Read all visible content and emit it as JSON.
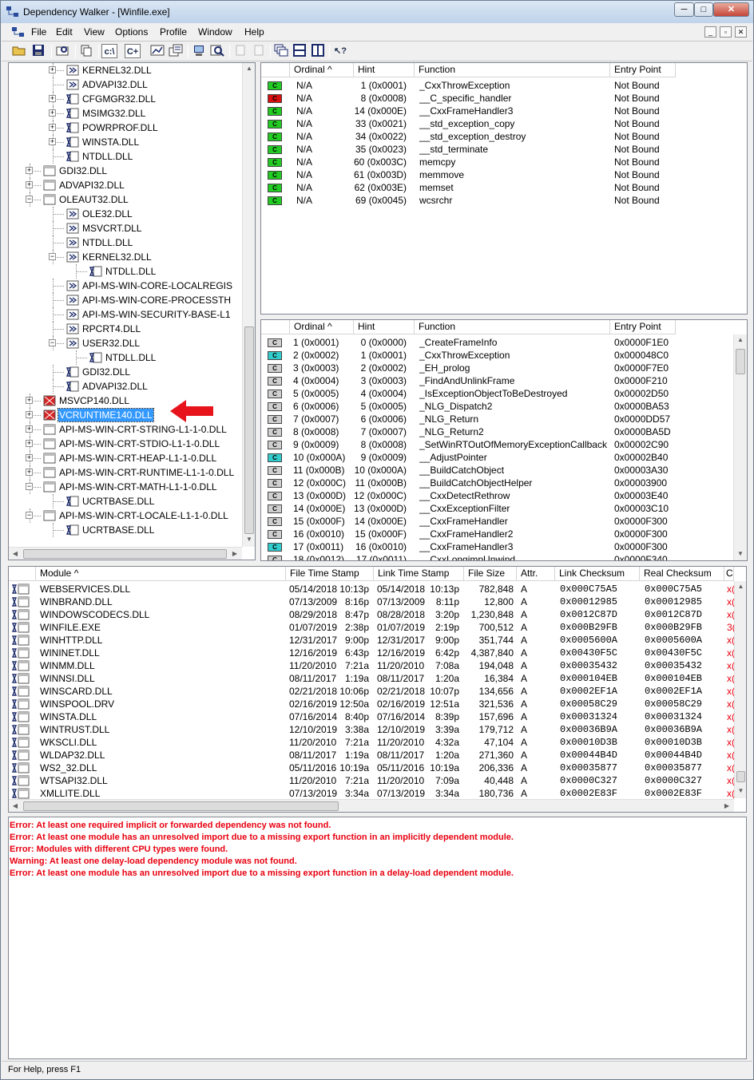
{
  "window": {
    "title": "Dependency Walker - [Winfile.exe]",
    "min": "─",
    "max": "□",
    "close": "✕"
  },
  "menu": [
    "File",
    "Edit",
    "View",
    "Options",
    "Profile",
    "Window",
    "Help"
  ],
  "mdi_controls": [
    "_",
    "▫",
    "✕"
  ],
  "toolbar": {
    "paths": "c:\\",
    "cpp": "C+"
  },
  "tree": [
    {
      "name": "KERNEL32.DLL",
      "depth": 2,
      "exp": "+",
      "icon": "forward"
    },
    {
      "name": "ADVAPI32.DLL",
      "depth": 2,
      "exp": "",
      "icon": "forward"
    },
    {
      "name": "CFGMGR32.DLL",
      "depth": 2,
      "exp": "+",
      "icon": "delay"
    },
    {
      "name": "MSIMG32.DLL",
      "depth": 2,
      "exp": "+",
      "icon": "delay"
    },
    {
      "name": "POWRPROF.DLL",
      "depth": 2,
      "exp": "+",
      "icon": "delay"
    },
    {
      "name": "WINSTA.DLL",
      "depth": 2,
      "exp": "+",
      "icon": "delay"
    },
    {
      "name": "NTDLL.DLL",
      "depth": 2,
      "exp": "",
      "icon": "delay"
    },
    {
      "name": "GDI32.DLL",
      "depth": 1,
      "exp": "+",
      "icon": "normal"
    },
    {
      "name": "ADVAPI32.DLL",
      "depth": 1,
      "exp": "+",
      "icon": "normal"
    },
    {
      "name": "OLEAUT32.DLL",
      "depth": 1,
      "exp": "-",
      "icon": "normal"
    },
    {
      "name": "OLE32.DLL",
      "depth": 2,
      "exp": "",
      "icon": "forward"
    },
    {
      "name": "MSVCRT.DLL",
      "depth": 2,
      "exp": "",
      "icon": "forward"
    },
    {
      "name": "NTDLL.DLL",
      "depth": 2,
      "exp": "",
      "icon": "forward"
    },
    {
      "name": "KERNEL32.DLL",
      "depth": 2,
      "exp": "-",
      "icon": "forward"
    },
    {
      "name": "NTDLL.DLL",
      "depth": 3,
      "exp": "",
      "icon": "delay"
    },
    {
      "name": "API-MS-WIN-CORE-LOCALREGIS",
      "depth": 2,
      "exp": "",
      "icon": "forward"
    },
    {
      "name": "API-MS-WIN-CORE-PROCESSTH",
      "depth": 2,
      "exp": "",
      "icon": "forward"
    },
    {
      "name": "API-MS-WIN-SECURITY-BASE-L1",
      "depth": 2,
      "exp": "",
      "icon": "forward"
    },
    {
      "name": "RPCRT4.DLL",
      "depth": 2,
      "exp": "",
      "icon": "forward"
    },
    {
      "name": "USER32.DLL",
      "depth": 2,
      "exp": "-",
      "icon": "forward"
    },
    {
      "name": "NTDLL.DLL",
      "depth": 3,
      "exp": "",
      "icon": "delay"
    },
    {
      "name": "GDI32.DLL",
      "depth": 2,
      "exp": "",
      "icon": "delay"
    },
    {
      "name": "ADVAPI32.DLL",
      "depth": 2,
      "exp": "",
      "icon": "delay"
    },
    {
      "name": "MSVCP140.DLL",
      "depth": 1,
      "exp": "+",
      "icon": "error"
    },
    {
      "name": "VCRUNTIME140.DLL",
      "depth": 1,
      "exp": "+",
      "icon": "error",
      "selected": true
    },
    {
      "name": "API-MS-WIN-CRT-STRING-L1-1-0.DLL",
      "depth": 1,
      "exp": "+",
      "icon": "normal"
    },
    {
      "name": "API-MS-WIN-CRT-STDIO-L1-1-0.DLL",
      "depth": 1,
      "exp": "+",
      "icon": "normal"
    },
    {
      "name": "API-MS-WIN-CRT-HEAP-L1-1-0.DLL",
      "depth": 1,
      "exp": "+",
      "icon": "normal"
    },
    {
      "name": "API-MS-WIN-CRT-RUNTIME-L1-1-0.DLL",
      "depth": 1,
      "exp": "+",
      "icon": "normal"
    },
    {
      "name": "API-MS-WIN-CRT-MATH-L1-1-0.DLL",
      "depth": 1,
      "exp": "-",
      "icon": "normal"
    },
    {
      "name": "UCRTBASE.DLL",
      "depth": 2,
      "exp": "",
      "icon": "delay"
    },
    {
      "name": "API-MS-WIN-CRT-LOCALE-L1-1-0.DLL",
      "depth": 1,
      "exp": "-",
      "icon": "normal"
    },
    {
      "name": "UCRTBASE.DLL",
      "depth": 2,
      "exp": "",
      "icon": "delay"
    }
  ],
  "imports": {
    "headers": [
      "Ordinal ^",
      "Hint",
      "Function",
      "Entry Point"
    ],
    "rows": [
      {
        "ico": "C",
        "color": "#22cc22",
        "ordinal": "N/A",
        "hint": "1 (0x0001)",
        "func": "_CxxThrowException",
        "entry": "Not Bound"
      },
      {
        "ico": "C",
        "color": "#d91010",
        "ordinal": "N/A",
        "hint": "8 (0x0008)",
        "func": "__C_specific_handler",
        "entry": "Not Bound"
      },
      {
        "ico": "C",
        "color": "#22cc22",
        "ordinal": "N/A",
        "hint": "14 (0x000E)",
        "func": "__CxxFrameHandler3",
        "entry": "Not Bound"
      },
      {
        "ico": "C",
        "color": "#22cc22",
        "ordinal": "N/A",
        "hint": "33 (0x0021)",
        "func": "__std_exception_copy",
        "entry": "Not Bound"
      },
      {
        "ico": "C",
        "color": "#22cc22",
        "ordinal": "N/A",
        "hint": "34 (0x0022)",
        "func": "__std_exception_destroy",
        "entry": "Not Bound"
      },
      {
        "ico": "C",
        "color": "#22cc22",
        "ordinal": "N/A",
        "hint": "35 (0x0023)",
        "func": "__std_terminate",
        "entry": "Not Bound"
      },
      {
        "ico": "C",
        "color": "#22cc22",
        "ordinal": "N/A",
        "hint": "60 (0x003C)",
        "func": "memcpy",
        "entry": "Not Bound"
      },
      {
        "ico": "C",
        "color": "#22cc22",
        "ordinal": "N/A",
        "hint": "61 (0x003D)",
        "func": "memmove",
        "entry": "Not Bound"
      },
      {
        "ico": "C",
        "color": "#22cc22",
        "ordinal": "N/A",
        "hint": "62 (0x003E)",
        "func": "memset",
        "entry": "Not Bound"
      },
      {
        "ico": "C",
        "color": "#22cc22",
        "ordinal": "N/A",
        "hint": "69 (0x0045)",
        "func": "wcsrchr",
        "entry": "Not Bound"
      }
    ]
  },
  "exports": {
    "headers": [
      "Ordinal ^",
      "Hint",
      "Function",
      "Entry Point"
    ],
    "rows": [
      {
        "color": "#d0d0d0",
        "ordinal": "1 (0x0001)",
        "hint": "0 (0x0000)",
        "func": "_CreateFrameInfo",
        "entry": "0x0000F1E0"
      },
      {
        "color": "#33cccc",
        "ordinal": "2 (0x0002)",
        "hint": "1 (0x0001)",
        "func": "_CxxThrowException",
        "entry": "0x000048C0"
      },
      {
        "color": "#d0d0d0",
        "ordinal": "3 (0x0003)",
        "hint": "2 (0x0002)",
        "func": "_EH_prolog",
        "entry": "0x0000F7E0"
      },
      {
        "color": "#d0d0d0",
        "ordinal": "4 (0x0004)",
        "hint": "3 (0x0003)",
        "func": "_FindAndUnlinkFrame",
        "entry": "0x0000F210"
      },
      {
        "color": "#d0d0d0",
        "ordinal": "5 (0x0005)",
        "hint": "4 (0x0004)",
        "func": "_IsExceptionObjectToBeDestroyed",
        "entry": "0x00002D50"
      },
      {
        "color": "#d0d0d0",
        "ordinal": "6 (0x0006)",
        "hint": "5 (0x0005)",
        "func": "_NLG_Dispatch2",
        "entry": "0x0000BA53"
      },
      {
        "color": "#d0d0d0",
        "ordinal": "7 (0x0007)",
        "hint": "6 (0x0006)",
        "func": "_NLG_Return",
        "entry": "0x0000DD57"
      },
      {
        "color": "#d0d0d0",
        "ordinal": "8 (0x0008)",
        "hint": "7 (0x0007)",
        "func": "_NLG_Return2",
        "entry": "0x0000BA5D"
      },
      {
        "color": "#d0d0d0",
        "ordinal": "9 (0x0009)",
        "hint": "8 (0x0008)",
        "func": "_SetWinRTOutOfMemoryExceptionCallback",
        "entry": "0x00002C90"
      },
      {
        "color": "#33cccc",
        "ordinal": "10 (0x000A)",
        "hint": "9 (0x0009)",
        "func": "__AdjustPointer",
        "entry": "0x00002B40"
      },
      {
        "color": "#d0d0d0",
        "ordinal": "11 (0x000B)",
        "hint": "10 (0x000A)",
        "func": "__BuildCatchObject",
        "entry": "0x00003A30"
      },
      {
        "color": "#d0d0d0",
        "ordinal": "12 (0x000C)",
        "hint": "11 (0x000B)",
        "func": "__BuildCatchObjectHelper",
        "entry": "0x00003900"
      },
      {
        "color": "#d0d0d0",
        "ordinal": "13 (0x000D)",
        "hint": "12 (0x000C)",
        "func": "__CxxDetectRethrow",
        "entry": "0x00003E40"
      },
      {
        "color": "#d0d0d0",
        "ordinal": "14 (0x000E)",
        "hint": "13 (0x000D)",
        "func": "__CxxExceptionFilter",
        "entry": "0x00003C10"
      },
      {
        "color": "#d0d0d0",
        "ordinal": "15 (0x000F)",
        "hint": "14 (0x000E)",
        "func": "__CxxFrameHandler",
        "entry": "0x0000F300"
      },
      {
        "color": "#d0d0d0",
        "ordinal": "16 (0x0010)",
        "hint": "15 (0x000F)",
        "func": "__CxxFrameHandler2",
        "entry": "0x0000F300"
      },
      {
        "color": "#33cccc",
        "ordinal": "17 (0x0011)",
        "hint": "16 (0x0010)",
        "func": "__CxxFrameHandler3",
        "entry": "0x0000F300"
      },
      {
        "color": "#d0d0d0",
        "ordinal": "18 (0x0012)",
        "hint": "17 (0x0011)",
        "func": "__CxxLongjmpUnwind",
        "entry": "0x0000F340"
      }
    ]
  },
  "modules": {
    "headers": [
      "Module ^",
      "File Time Stamp",
      "Link Time Stamp",
      "File Size",
      "Attr.",
      "Link Checksum",
      "Real Checksum",
      "C"
    ],
    "rows": [
      {
        "name": "WEBSERVICES.DLL",
        "fdate": "05/14/2018",
        "ftime": "10:13p",
        "ldate": "05/14/2018",
        "ltime": "10:13p",
        "size": "782,848",
        "attr": "A",
        "lcs": "0x000C75A5",
        "rcs": "0x000C75A5",
        "c": "x("
      },
      {
        "name": "WINBRAND.DLL",
        "fdate": "07/13/2009",
        "ftime": "8:16p",
        "ldate": "07/13/2009",
        "ltime": "8:11p",
        "size": "12,800",
        "attr": "A",
        "lcs": "0x00012985",
        "rcs": "0x00012985",
        "c": "x("
      },
      {
        "name": "WINDOWSCODECS.DLL",
        "fdate": "08/29/2018",
        "ftime": "8:47p",
        "ldate": "08/28/2018",
        "ltime": "3:20p",
        "size": "1,230,848",
        "attr": "A",
        "lcs": "0x0012C87D",
        "rcs": "0x0012C87D",
        "c": "x("
      },
      {
        "name": "WINFILE.EXE",
        "fdate": "01/07/2019",
        "ftime": "2:38p",
        "ldate": "01/07/2019",
        "ltime": "2:19p",
        "size": "700,512",
        "attr": "A",
        "lcs": "0x000B29FB",
        "rcs": "0x000B29FB",
        "c": "3("
      },
      {
        "name": "WINHTTP.DLL",
        "fdate": "12/31/2017",
        "ftime": "9:00p",
        "ldate": "12/31/2017",
        "ltime": "9:00p",
        "size": "351,744",
        "attr": "A",
        "lcs": "0x0005600A",
        "rcs": "0x0005600A",
        "c": "x("
      },
      {
        "name": "WININET.DLL",
        "fdate": "12/16/2019",
        "ftime": "6:43p",
        "ldate": "12/16/2019",
        "ltime": "6:42p",
        "size": "4,387,840",
        "attr": "A",
        "lcs": "0x00430F5C",
        "rcs": "0x00430F5C",
        "c": "x("
      },
      {
        "name": "WINMM.DLL",
        "fdate": "11/20/2010",
        "ftime": "7:21a",
        "ldate": "11/20/2010",
        "ltime": "7:08a",
        "size": "194,048",
        "attr": "A",
        "lcs": "0x00035432",
        "rcs": "0x00035432",
        "c": "x("
      },
      {
        "name": "WINNSI.DLL",
        "fdate": "08/11/2017",
        "ftime": "1:19a",
        "ldate": "08/11/2017",
        "ltime": "1:20a",
        "size": "16,384",
        "attr": "A",
        "lcs": "0x000104EB",
        "rcs": "0x000104EB",
        "c": "x("
      },
      {
        "name": "WINSCARD.DLL",
        "fdate": "02/21/2018",
        "ftime": "10:06p",
        "ldate": "02/21/2018",
        "ltime": "10:07p",
        "size": "134,656",
        "attr": "A",
        "lcs": "0x0002EF1A",
        "rcs": "0x0002EF1A",
        "c": "x("
      },
      {
        "name": "WINSPOOL.DRV",
        "fdate": "02/16/2019",
        "ftime": "12:50a",
        "ldate": "02/16/2019",
        "ltime": "12:51a",
        "size": "321,536",
        "attr": "A",
        "lcs": "0x00058C29",
        "rcs": "0x00058C29",
        "c": "x("
      },
      {
        "name": "WINSTA.DLL",
        "fdate": "07/16/2014",
        "ftime": "8:40p",
        "ldate": "07/16/2014",
        "ltime": "8:39p",
        "size": "157,696",
        "attr": "A",
        "lcs": "0x00031324",
        "rcs": "0x00031324",
        "c": "x("
      },
      {
        "name": "WINTRUST.DLL",
        "fdate": "12/10/2019",
        "ftime": "3:38a",
        "ldate": "12/10/2019",
        "ltime": "3:39a",
        "size": "179,712",
        "attr": "A",
        "lcs": "0x00036B9A",
        "rcs": "0x00036B9A",
        "c": "x("
      },
      {
        "name": "WKSCLI.DLL",
        "fdate": "11/20/2010",
        "ftime": "7:21a",
        "ldate": "11/20/2010",
        "ltime": "4:32a",
        "size": "47,104",
        "attr": "A",
        "lcs": "0x00010D3B",
        "rcs": "0x00010D3B",
        "c": "x("
      },
      {
        "name": "WLDAP32.DLL",
        "fdate": "08/11/2017",
        "ftime": "1:19a",
        "ldate": "08/11/2017",
        "ltime": "1:20a",
        "size": "271,360",
        "attr": "A",
        "lcs": "0x00044B4D",
        "rcs": "0x00044B4D",
        "c": "x("
      },
      {
        "name": "WS2_32.DLL",
        "fdate": "05/11/2016",
        "ftime": "10:19a",
        "ldate": "05/11/2016",
        "ltime": "10:19a",
        "size": "206,336",
        "attr": "A",
        "lcs": "0x00035877",
        "rcs": "0x00035877",
        "c": "x("
      },
      {
        "name": "WTSAPI32.DLL",
        "fdate": "11/20/2010",
        "ftime": "7:21a",
        "ldate": "11/20/2010",
        "ltime": "7:09a",
        "size": "40,448",
        "attr": "A",
        "lcs": "0x0000C327",
        "rcs": "0x0000C327",
        "c": "x("
      },
      {
        "name": "XMLLITE.DLL",
        "fdate": "07/13/2019",
        "ftime": "3:34a",
        "ldate": "07/13/2019",
        "ltime": "3:34a",
        "size": "180,736",
        "attr": "A",
        "lcs": "0x0002E83F",
        "rcs": "0x0002E83F",
        "c": "x("
      }
    ]
  },
  "log": [
    "Error: At least one required implicit or forwarded dependency was not found.",
    "Error: At least one module has an unresolved import due to a missing export function in an implicitly dependent module.",
    "Error: Modules with different CPU types were found.",
    "Warning: At least one delay-load dependency module was not found.",
    "Error: At least one module has an unresolved import due to a missing export function in a delay-load dependent module."
  ],
  "status": "For Help, press F1",
  "colors": {
    "accent": "#3399ff",
    "error": "#e8000f",
    "arrow": "#e8141c"
  }
}
